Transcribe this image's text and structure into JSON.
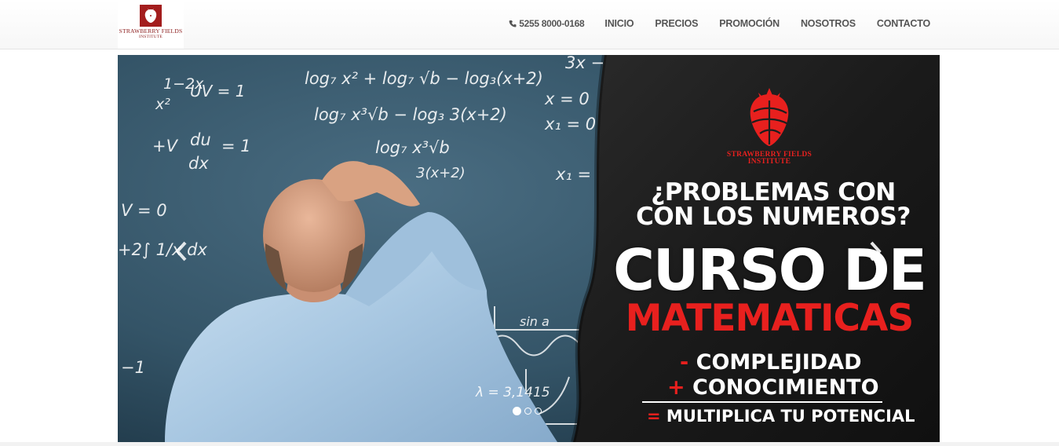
{
  "header": {
    "logo": {
      "line1": "STRAWBERRY FIELDS",
      "line2": "INSTITUTE"
    },
    "phone": "5255 8000-0168",
    "nav": [
      "INICIO",
      "PRECIOS",
      "PROMOCIÓN",
      "NOSOTROS",
      "CONTACTO"
    ]
  },
  "slider": {
    "chalkboard": [
      "1−2x",
      "x²",
      "UV = 1",
      "log₇ x² + log₇ √b − log₃(x+2)",
      "log₇ x³√b − log₃ 3(x+2)",
      "log₇ x³√b",
      "3(x+2)",
      "du",
      "dx",
      "+V",
      "= 1",
      "V = 0",
      "+2∫ 1/x dx",
      "x = 0",
      "x₁ = 0",
      "3x −",
      "x₁ =",
      "−1",
      "sin a",
      "λ = 3,1415"
    ],
    "promo": {
      "logo_line1": "STRAWBERRY FIELDS",
      "logo_line2": "INSTITUTE",
      "question_line1": "¿PROBLEMAS CON",
      "question_line2": "CON LOS NUMEROS?",
      "headline": "CURSO DE",
      "subject": "MATEMATICAS",
      "minus_symbol": "-",
      "line_minus": "COMPLEJIDAD",
      "plus_symbol": "+",
      "line_plus": "CONOCIMIENTO",
      "equals_symbol": "=",
      "line_equals": "MULTIPLICA TU POTENCIAL"
    },
    "dots_count": 3,
    "active_dot": 1
  },
  "colors": {
    "accent_red": "#e8201e",
    "nav_text": "#555555",
    "board_blue": "#2f4e61",
    "panel_dark": "#1e1e1e"
  }
}
